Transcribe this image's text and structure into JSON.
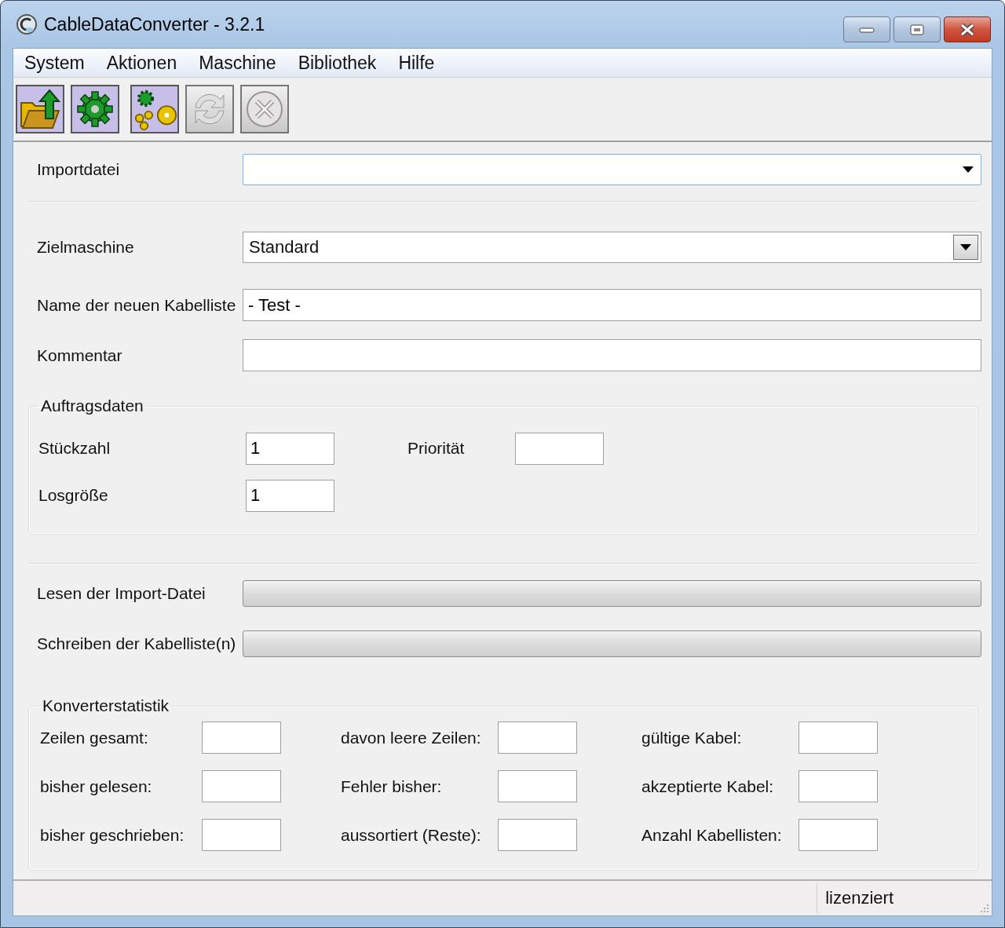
{
  "window": {
    "title": "CableDataConverter - 3.2.1"
  },
  "menu": [
    "System",
    "Aktionen",
    "Maschine",
    "Bibliothek",
    "Hilfe"
  ],
  "toolbar": [
    {
      "kind": "open",
      "disabled": false
    },
    {
      "kind": "gear",
      "disabled": false
    },
    {
      "kind": "gears",
      "disabled": false
    },
    {
      "kind": "refresh",
      "disabled": true
    },
    {
      "kind": "cancel",
      "disabled": true
    }
  ],
  "import_file": {
    "label": "Importdatei"
  },
  "target_machine": {
    "label": "Zielmaschine",
    "value": "Standard"
  },
  "list_name": {
    "label": "Name der neuen Kabelliste",
    "value": "- Test -"
  },
  "comment": {
    "label": "Kommentar"
  },
  "order_data": {
    "title": "Auftragsdaten",
    "quantity": {
      "label": "Stückzahl",
      "value": "1"
    },
    "priority": {
      "label": "Priorität"
    },
    "batch_size": {
      "label": "Losgröße",
      "value": "1"
    }
  },
  "progress": [
    {
      "label": "Lesen der Import-Datei",
      "level": 0
    },
    {
      "label": "Schreiben der Kabelliste(n)",
      "level": 0
    }
  ],
  "statistics": {
    "title": "Konverterstatistik",
    "fields": [
      {
        "label": "Zeilen gesamt:"
      },
      {
        "label": "davon leere Zeilen:"
      },
      {
        "label": "gültige Kabel:"
      },
      {
        "label": "bisher gelesen:"
      },
      {
        "label": "Fehler bisher:"
      },
      {
        "label": "akzeptierte Kabel:"
      },
      {
        "label": "bisher geschrieben:"
      },
      {
        "label": "aussortiert (Reste):"
      },
      {
        "label": "Anzahl Kabellisten:"
      }
    ]
  },
  "status_bar": {
    "text": "lizenziert"
  }
}
